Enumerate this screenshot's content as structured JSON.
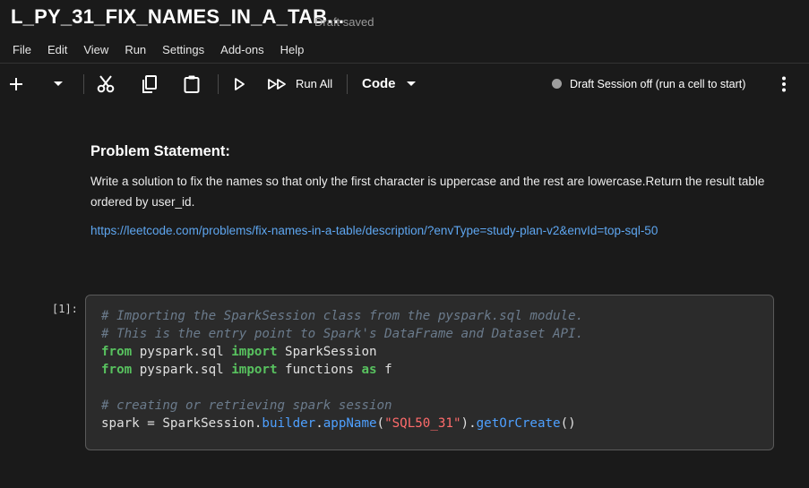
{
  "notebook": {
    "title": "L_PY_31_FIX_NAMES_IN_A_TAB...",
    "draft_status": "Draft saved"
  },
  "menu": [
    "File",
    "Edit",
    "View",
    "Run",
    "Settings",
    "Add-ons",
    "Help"
  ],
  "toolbar": {
    "run_all_label": "Run All",
    "cell_type": "Code",
    "session_status": "Draft Session off (run a cell to start)",
    "session_dot_color": "#9e9e9e"
  },
  "markdown_cell": {
    "heading": "Problem Statement:",
    "body": "Write a solution to fix the names so that only the first character is uppercase and the rest are lowercase.Return the result table ordered by user_id.",
    "link": "https://leetcode.com/problems/fix-names-in-a-table/description/?envType=study-plan-v2&envId=top-sql-50"
  },
  "code_cell": {
    "execution_count": "[1]:",
    "comment1": "# Importing the SparkSession class from the pyspark.sql module.",
    "comment2": "# This is the entry point to Spark's DataFrame and Dataset API.",
    "kw_from": "from",
    "module": "pyspark.sql",
    "kw_import": "import",
    "name_sparksession": "SparkSession",
    "name_functions": "functions",
    "kw_as": "as",
    "alias_f": "f",
    "comment3": "# creating or retrieving spark session",
    "var_spark": "spark",
    "op_eq": "=",
    "attr_builder": "builder",
    "attr_appname": "appName",
    "str_app": "\"SQL50_31\"",
    "attr_getorcreate": "getOrCreate",
    "dot": ".",
    "paren_open": "(",
    "paren_close": ")",
    "paren_pair": "()"
  },
  "colors": {
    "background": "#1a1a1a",
    "keyword": "#58c25f",
    "string": "#ff6b6b",
    "comment": "#6b7b8c",
    "link": "#5ea6f0"
  }
}
